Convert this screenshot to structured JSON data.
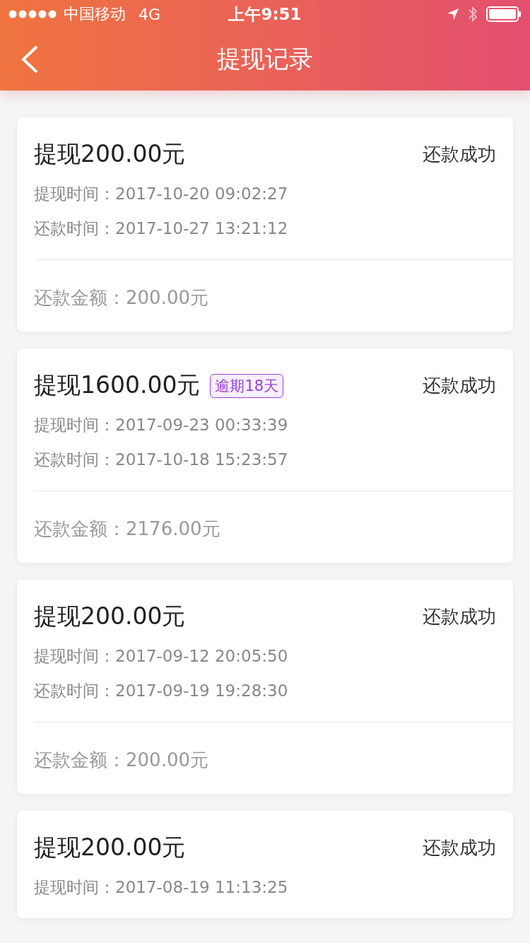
{
  "status_bar": {
    "carrier": "中国移动",
    "network": "4G",
    "time": "上午9:51"
  },
  "header": {
    "title": "提现记录"
  },
  "records": [
    {
      "title": "提现200.00元",
      "status": "还款成功",
      "times": [
        {
          "label": "提现时间：",
          "value": "2017-10-20 09:02:27"
        },
        {
          "label": "还款时间：",
          "value": "2017-10-27 13:21:12"
        }
      ],
      "amount": {
        "label": "还款金额：",
        "value": "200.00元"
      }
    },
    {
      "title": "提现1600.00元",
      "badge": "逾期18天",
      "status": "还款成功",
      "times": [
        {
          "label": "提现时间：",
          "value": "2017-09-23 00:33:39"
        },
        {
          "label": "还款时间：",
          "value": "2017-10-18 15:23:57"
        }
      ],
      "amount": {
        "label": "还款金额：",
        "value": "2176.00元"
      }
    },
    {
      "title": "提现200.00元",
      "status": "还款成功",
      "times": [
        {
          "label": "提现时间：",
          "value": "2017-09-12 20:05:50"
        },
        {
          "label": "还款时间：",
          "value": "2017-09-19 19:28:30"
        }
      ],
      "amount": {
        "label": "还款金额：",
        "value": "200.00元"
      }
    },
    {
      "title": "提现200.00元",
      "status": "还款成功",
      "times": [
        {
          "label": "提现时间：",
          "value": "2017-08-19 11:13:25"
        }
      ]
    }
  ]
}
